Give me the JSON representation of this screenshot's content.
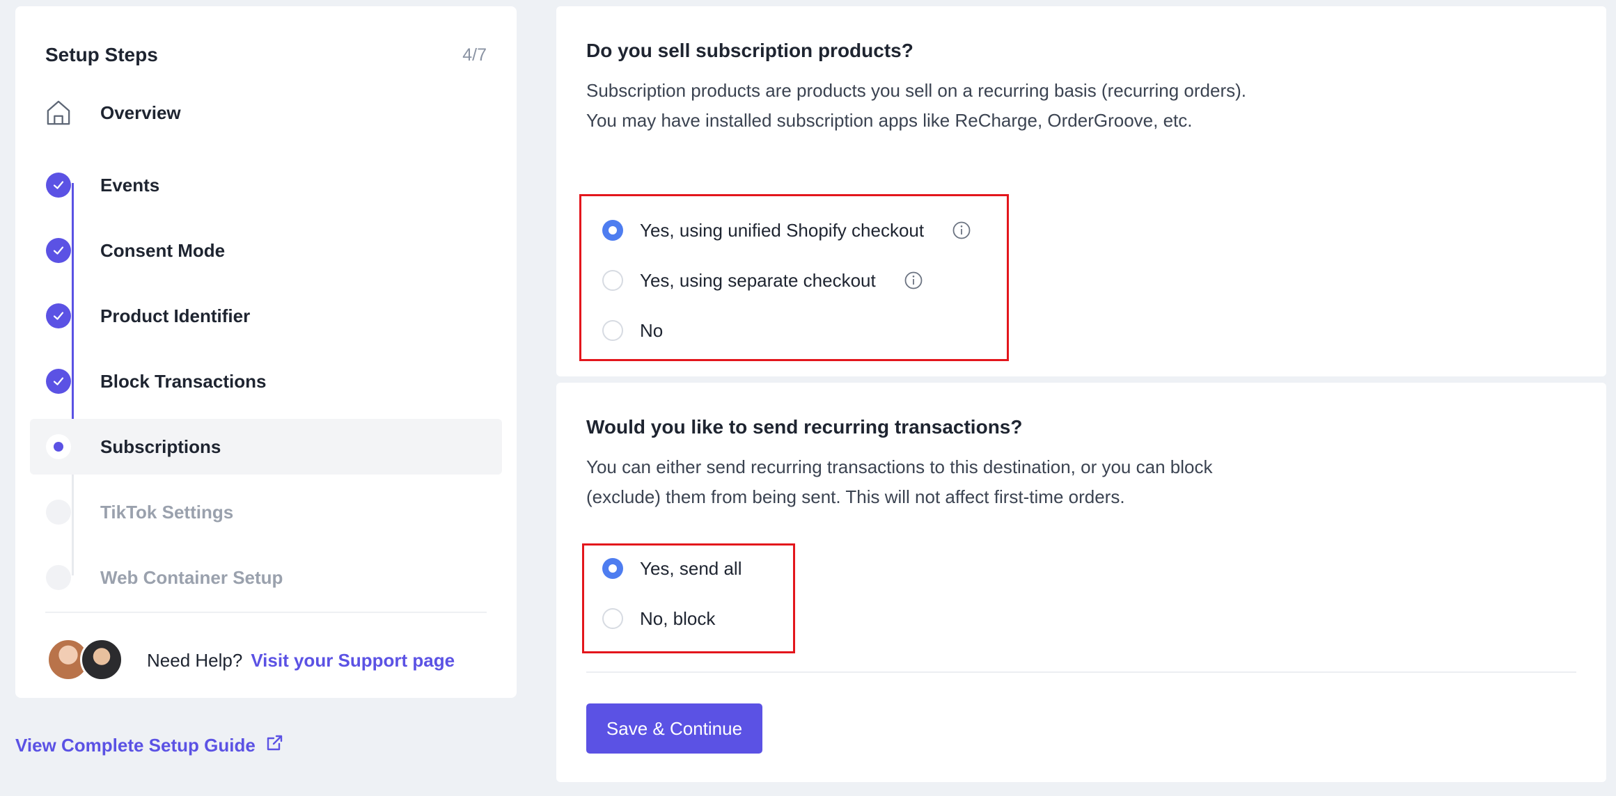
{
  "sidebar": {
    "title": "Setup Steps",
    "progress": "4/7",
    "steps": [
      {
        "label": "Overview",
        "status": "home",
        "icon": "home-icon"
      },
      {
        "label": "Events",
        "status": "done"
      },
      {
        "label": "Consent Mode",
        "status": "done"
      },
      {
        "label": "Product Identifier",
        "status": "done"
      },
      {
        "label": "Block Transactions",
        "status": "done"
      },
      {
        "label": "Subscriptions",
        "status": "current"
      },
      {
        "label": "TikTok Settings",
        "status": "todo"
      },
      {
        "label": "Web Container Setup",
        "status": "todo"
      }
    ],
    "help_text": "Need Help?",
    "help_link": "Visit your Support page"
  },
  "guide_link": "View Complete Setup Guide",
  "subscription_question": {
    "title": "Do you sell subscription products?",
    "description": "Subscription products are products you sell on a recurring basis (recurring orders). You may have installed subscription apps like ReCharge, OrderGroove, etc.",
    "options": [
      {
        "label": "Yes, using unified Shopify checkout",
        "checked": true,
        "info": true
      },
      {
        "label": "Yes, using separate checkout",
        "checked": false,
        "info": true
      },
      {
        "label": "No",
        "checked": false,
        "info": false
      }
    ]
  },
  "recurring_question": {
    "title": "Would you like to send recurring transactions?",
    "description": "You can either send recurring transactions to this destination, or you can block (exclude) them from being sent. This will not affect first-time orders.",
    "options": [
      {
        "label": "Yes, send all",
        "checked": true
      },
      {
        "label": "No, block",
        "checked": false
      }
    ]
  },
  "save_button": "Save & Continue",
  "colors": {
    "accent": "#5b52e4",
    "radio_checked": "#4e7df0",
    "highlight_box": "#e3161c",
    "background": "#eef1f5"
  }
}
